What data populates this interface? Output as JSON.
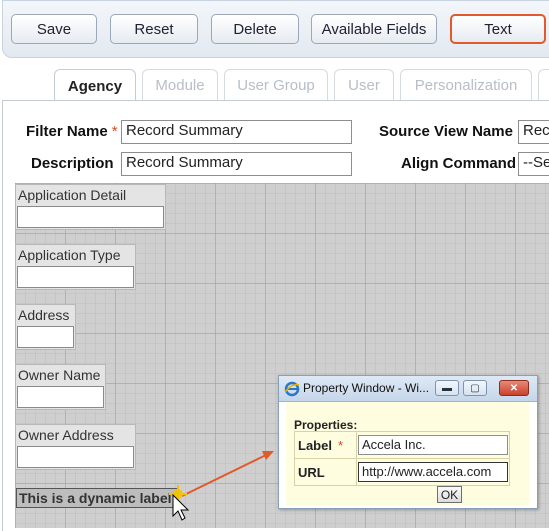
{
  "toolbar": {
    "save": "Save",
    "reset": "Reset",
    "delete": "Delete",
    "available_fields": "Available Fields",
    "text": "Text"
  },
  "tabs": [
    "Agency",
    "Module",
    "User Group",
    "User",
    "Personalization"
  ],
  "form": {
    "filter_name_label": "Filter Name",
    "filter_name_value": "Record Summary",
    "description_label": "Description",
    "description_value": "Record Summary",
    "source_view_label": "Source View Name",
    "source_view_value": "Rec",
    "align_command_label": "Align Command",
    "align_command_value": "--Se",
    "required_mark": "*"
  },
  "canvas_fields": [
    "Application Detail",
    "Application Type",
    "Address",
    "Owner Name",
    "Owner Address"
  ],
  "dynamic_label": "This is a dynamic label",
  "popup": {
    "title": "Property Window - Wi...",
    "properties_heading": "Properties:",
    "label_field": "Label",
    "label_value": "Accela Inc.",
    "url_field": "URL",
    "url_value": "http://www.accela.com",
    "ok": "OK",
    "required_mark": "*"
  },
  "colors": {
    "active_border": "#e05a2b",
    "arrow": "#e05a2b",
    "popup_body": "#fffde0"
  }
}
